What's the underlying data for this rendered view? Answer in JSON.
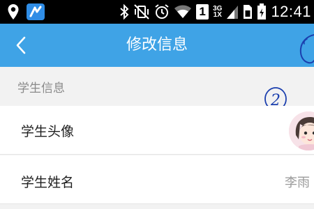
{
  "status_bar": {
    "time": "12:41",
    "network_top": "3G",
    "network_bottom": "1X",
    "sim_slot": "1"
  },
  "header": {
    "title": "修改信息"
  },
  "section": {
    "title": "学生信息"
  },
  "annotation": {
    "number": "2"
  },
  "rows": [
    {
      "label": "学生头像"
    },
    {
      "label": "学生姓名",
      "value": "李雨"
    }
  ],
  "colors": {
    "header_bg": "#3fa3e6",
    "status_bar_bg": "#000000",
    "page_bg": "#f2f2f2",
    "annotation_ink": "#1b3fae"
  }
}
